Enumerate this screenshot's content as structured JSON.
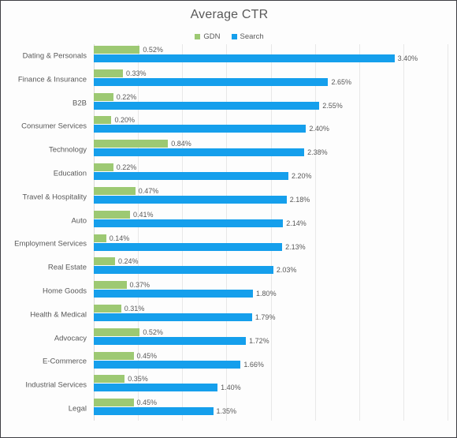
{
  "chart_data": {
    "type": "bar",
    "orientation": "horizontal",
    "title": "Average CTR",
    "xlabel": "",
    "ylabel": "",
    "xlim": [
      0,
      4.0
    ],
    "xtick_interval": 0.5,
    "xticks_visible": false,
    "grid": true,
    "legend_position": "top-center",
    "value_suffix": "%",
    "categories": [
      "Dating & Personals",
      "Finance & Insurance",
      "B2B",
      "Consumer Services",
      "Technology",
      "Education",
      "Travel & Hospitality",
      "Auto",
      "Employment Services",
      "Real Estate",
      "Home Goods",
      "Health & Medical",
      "Advocacy",
      "E-Commerce",
      "Industrial Services",
      "Legal"
    ],
    "series": [
      {
        "name": "GDN",
        "color": "#9DC973",
        "values": [
          0.52,
          0.33,
          0.22,
          0.2,
          0.84,
          0.22,
          0.47,
          0.41,
          0.14,
          0.24,
          0.37,
          0.31,
          0.52,
          0.45,
          0.35,
          0.45
        ],
        "labels": [
          "0.52%",
          "0.33%",
          "0.22%",
          "0.20%",
          "0.84%",
          "0.22%",
          "0.47%",
          "0.41%",
          "0.14%",
          "0.24%",
          "0.37%",
          "0.31%",
          "0.52%",
          "0.45%",
          "0.35%",
          "0.45%"
        ]
      },
      {
        "name": "Search",
        "color": "#159FEC",
        "values": [
          3.4,
          2.65,
          2.55,
          2.4,
          2.38,
          2.2,
          2.18,
          2.14,
          2.13,
          2.03,
          1.8,
          1.79,
          1.72,
          1.66,
          1.4,
          1.35
        ],
        "labels": [
          "3.40%",
          "2.65%",
          "2.55%",
          "2.40%",
          "2.38%",
          "2.20%",
          "2.18%",
          "2.14%",
          "2.13%",
          "2.03%",
          "1.80%",
          "1.79%",
          "1.72%",
          "1.66%",
          "1.40%",
          "1.35%"
        ]
      }
    ]
  },
  "legend": {
    "items": [
      {
        "label": "GDN",
        "color": "#9DC973"
      },
      {
        "label": "Search",
        "color": "#159FEC"
      }
    ]
  },
  "colors": {
    "gdn": "#9DC973",
    "search": "#159FEC",
    "text": "#595959",
    "gridline": "#e8e8e8",
    "border": "#3f3f44",
    "background": "#fdfdfd"
  }
}
